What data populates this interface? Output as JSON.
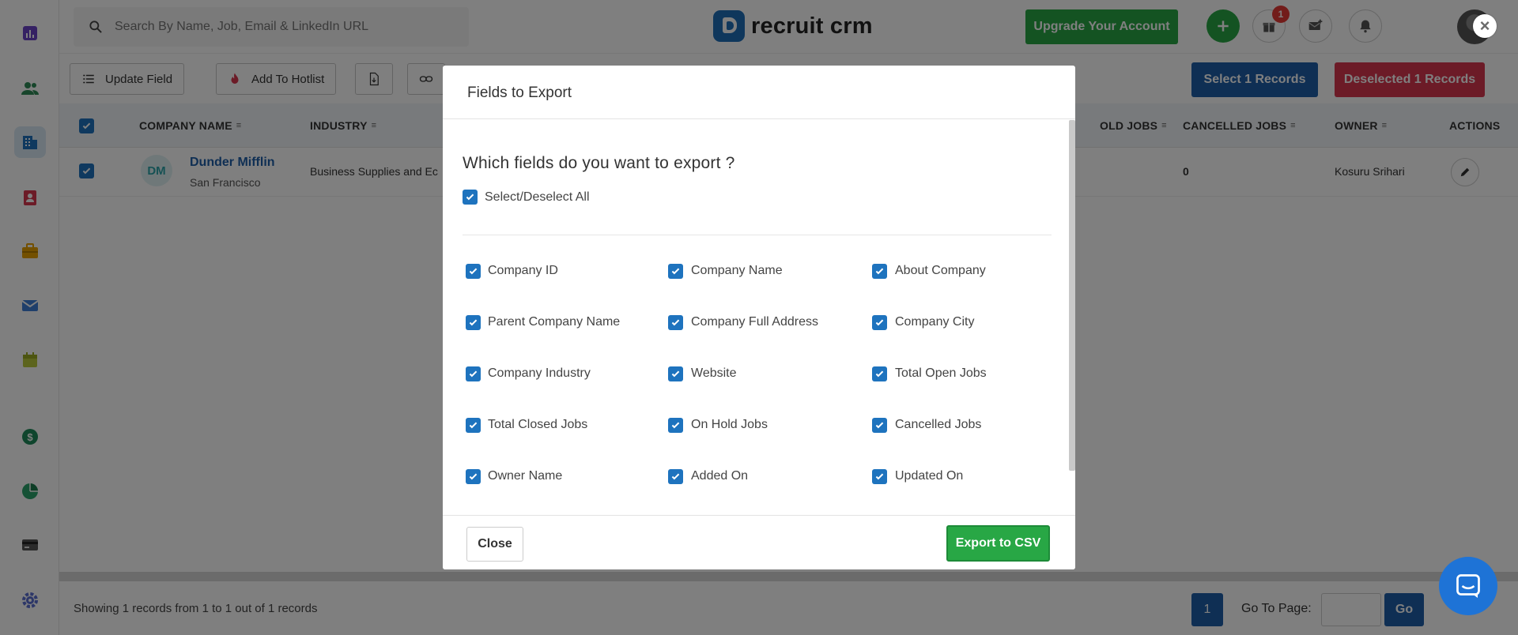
{
  "search": {
    "placeholder": "Search By Name, Job, Email & LinkedIn URL"
  },
  "brand": {
    "name": "recruit crm"
  },
  "header": {
    "upgrade_label": "Upgrade Your Account",
    "gift_badge": "1"
  },
  "toolbar": {
    "update_field": "Update Field",
    "add_to_hotlist": "Add To Hotlist",
    "select_records": "Select  1  Records",
    "deselected_records": "Deselected 1 Records"
  },
  "table": {
    "columns": {
      "company_name": "COMPANY NAME",
      "industry": "INDUSTRY",
      "on_hold_jobs": "OLD JOBS",
      "cancelled_jobs": "CANCELLED JOBS",
      "owner": "OWNER",
      "actions": "ACTIONS"
    },
    "row": {
      "initials": "DM",
      "name": "Dunder Mifflin",
      "city": "San Francisco",
      "industry": "Business Supplies and Ec",
      "cancelled_jobs": "0",
      "owner": "Kosuru Srihari"
    }
  },
  "footer": {
    "showing": "Showing 1 records from 1 to 1 out of 1 records",
    "page": "1",
    "goto_label": "Go To Page:",
    "go": "Go"
  },
  "modal": {
    "title": "Fields to Export",
    "question": "Which fields do you want to export ?",
    "select_all": "Select/Deselect All",
    "fields": [
      "Company ID",
      "Company Name",
      "About Company",
      "Parent Company Name",
      "Company Full Address",
      "Company City",
      "Company Industry",
      "Website",
      "Total Open Jobs",
      "Total Closed Jobs",
      "On Hold Jobs",
      "Cancelled Jobs",
      "Owner Name",
      "Added On",
      "Updated On"
    ],
    "close": "Close",
    "export": "Export to CSV"
  },
  "colors": {
    "primary": "#1e5fa8",
    "success": "#28a745",
    "danger": "#d9364f"
  }
}
